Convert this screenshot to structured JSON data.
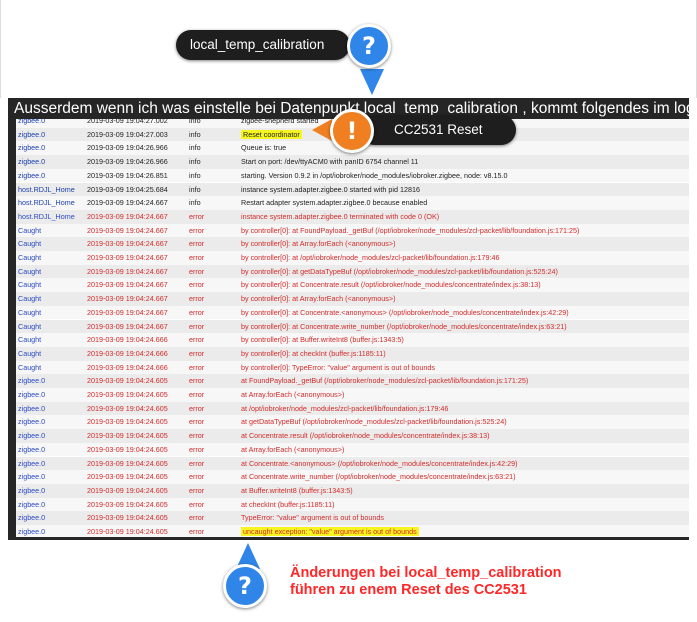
{
  "callout_top": {
    "label": "local_temp_calibration",
    "badge": "?"
  },
  "callout_reset": {
    "label": "CC2531 Reset",
    "badge": "!"
  },
  "callout_bottom": {
    "badge": "?",
    "line1": "Änderungen bei local_temp_calibration",
    "line2": "führen zu enem Reset des CC2531"
  },
  "screenshot": {
    "title": "Ausserdem wenn ich was einstelle bei Datenpunkt local_temp_calibration , kommt folgendes im log"
  },
  "log_rows": [
    {
      "source": "zigbee.0",
      "time": "2019-03-09 19:04:27.002",
      "severity": "info",
      "message": "zigbee-shepherd started"
    },
    {
      "source": "zigbee.0",
      "time": "2019-03-09 19:04:27.003",
      "severity": "info",
      "message": "Reset coordinator"
    },
    {
      "source": "zigbee.0",
      "time": "2019-03-09 19:04:26.966",
      "severity": "info",
      "message": "Queue is: true"
    },
    {
      "source": "zigbee.0",
      "time": "2019-03-09 19:04:26.966",
      "severity": "info",
      "message": "Start on port: /dev/ttyACM0 with panID 6754 channel 11"
    },
    {
      "source": "zigbee.0",
      "time": "2019-03-09 19:04:26.851",
      "severity": "info",
      "message": "starting. Version 0.9.2 in /opt/iobroker/node_modules/iobroker.zigbee, node: v8.15.0"
    },
    {
      "source": "host.RDJL_Home",
      "time": "2019-03-09 19:04:25.684",
      "severity": "info",
      "message": "instance system.adapter.zigbee.0 started with pid 12816"
    },
    {
      "source": "host.RDJL_Home",
      "time": "2019-03-09 19:04:24.667",
      "severity": "info",
      "message": "Restart adapter system.adapter.zigbee.0 because enabled"
    },
    {
      "source": "host.RDJL_Home",
      "time": "2019-03-09 19:04:24.667",
      "severity": "error",
      "message": "instance system.adapter.zigbee.0 terminated with code 0 (OK)"
    },
    {
      "source": "Caught",
      "time": "2019-03-09 19:04:24.667",
      "severity": "error",
      "message": "by controller[0]: at FoundPayload._getBuf (/opt/iobroker/node_modules/zcl-packet/lib/foundation.js:171:25)"
    },
    {
      "source": "Caught",
      "time": "2019-03-09 19:04:24.667",
      "severity": "error",
      "message": "by controller[0]: at Array.forEach (<anonymous>)"
    },
    {
      "source": "Caught",
      "time": "2019-03-09 19:04:24.667",
      "severity": "error",
      "message": "by controller[0]: at /opt/iobroker/node_modules/zcl-packet/lib/foundation.js:179:46"
    },
    {
      "source": "Caught",
      "time": "2019-03-09 19:04:24.667",
      "severity": "error",
      "message": "by controller[0]: at getDataTypeBuf (/opt/iobroker/node_modules/zcl-packet/lib/foundation.js:525:24)"
    },
    {
      "source": "Caught",
      "time": "2019-03-09 19:04:24.667",
      "severity": "error",
      "message": "by controller[0]: at Concentrate.result (/opt/iobroker/node_modules/concentrate/index.js:38:13)"
    },
    {
      "source": "Caught",
      "time": "2019-03-09 19:04:24.667",
      "severity": "error",
      "message": "by controller[0]: at Array.forEach (<anonymous>)"
    },
    {
      "source": "Caught",
      "time": "2019-03-09 19:04:24.667",
      "severity": "error",
      "message": "by controller[0]: at Concentrate.<anonymous> (/opt/iobroker/node_modules/concentrate/index.js:42:29)"
    },
    {
      "source": "Caught",
      "time": "2019-03-09 19:04:24.667",
      "severity": "error",
      "message": "by controller[0]: at Concentrate.write_number (/opt/iobroker/node_modules/concentrate/index.js:63:21)"
    },
    {
      "source": "Caught",
      "time": "2019-03-09 19:04:24.666",
      "severity": "error",
      "message": "by controller[0]: at Buffer.writeInt8 (buffer.js:1343:5)"
    },
    {
      "source": "Caught",
      "time": "2019-03-09 19:04:24.666",
      "severity": "error",
      "message": "by controller[0]: at checkInt (buffer.js:1185:11)"
    },
    {
      "source": "Caught",
      "time": "2019-03-09 19:04:24.666",
      "severity": "error",
      "message": "by controller[0]: TypeError: \"value\" argument is out of bounds"
    },
    {
      "source": "zigbee.0",
      "time": "2019-03-09 19:04:24.605",
      "severity": "error",
      "message": "at FoundPayload._getBuf (/opt/iobroker/node_modules/zcl-packet/lib/foundation.js:171:25)"
    },
    {
      "source": "zigbee.0",
      "time": "2019-03-09 19:04:24.605",
      "severity": "error",
      "message": "at Array.forEach (<anonymous>)"
    },
    {
      "source": "zigbee.0",
      "time": "2019-03-09 19:04:24.605",
      "severity": "error",
      "message": "at /opt/iobroker/node_modules/zcl-packet/lib/foundation.js:179:46"
    },
    {
      "source": "zigbee.0",
      "time": "2019-03-09 19:04:24.605",
      "severity": "error",
      "message": "at getDataTypeBuf (/opt/iobroker/node_modules/zcl-packet/lib/foundation.js:525:24)"
    },
    {
      "source": "zigbee.0",
      "time": "2019-03-09 19:04:24.605",
      "severity": "error",
      "message": "at Concentrate.result (/opt/iobroker/node_modules/concentrate/index.js:38:13)"
    },
    {
      "source": "zigbee.0",
      "time": "2019-03-09 19:04:24.605",
      "severity": "error",
      "message": "at Array.forEach (<anonymous>)"
    },
    {
      "source": "zigbee.0",
      "time": "2019-03-09 19:04:24.605",
      "severity": "error",
      "message": "at Concentrate.<anonymous> (/opt/iobroker/node_modules/concentrate/index.js:42:29)"
    },
    {
      "source": "zigbee.0",
      "time": "2019-03-09 19:04:24.605",
      "severity": "error",
      "message": "at Concentrate.write_number (/opt/iobroker/node_modules/concentrate/index.js:63:21)"
    },
    {
      "source": "zigbee.0",
      "time": "2019-03-09 19:04:24.605",
      "severity": "error",
      "message": "at Buffer.writeInt8 (buffer.js:1343:5)"
    },
    {
      "source": "zigbee.0",
      "time": "2019-03-09 19:04:24.605",
      "severity": "error",
      "message": "at checkInt (buffer.js:1185:11)"
    },
    {
      "source": "zigbee.0",
      "time": "2019-03-09 19:04:24.605",
      "severity": "error",
      "message": "TypeError: \"value\" argument is out of bounds"
    },
    {
      "source": "zigbee.0",
      "time": "2019-03-09 19:04:24.605",
      "severity": "error",
      "message": "uncaught exception: \"value\" argument is out of bounds"
    }
  ],
  "highlighted_rows": [
    1,
    30
  ],
  "colors": {
    "highlight": "#f7f51f",
    "error_text": "#d42a2a",
    "source_text": "#1a3fb0",
    "callout_blue": "#2f86e8",
    "callout_orange": "#f07f22",
    "caption_red": "#ff2727"
  }
}
